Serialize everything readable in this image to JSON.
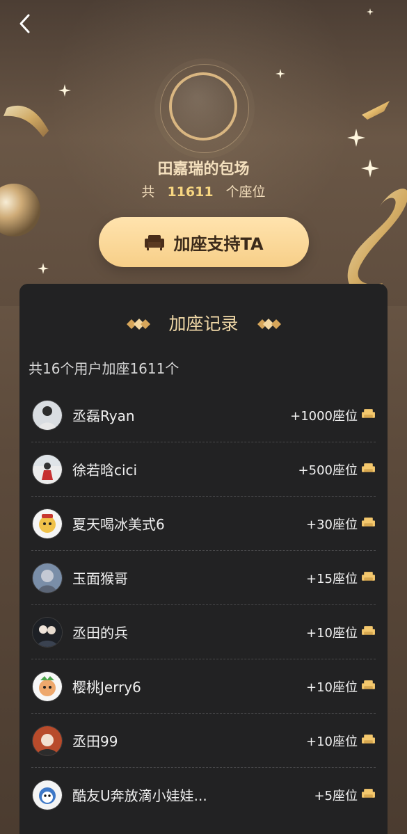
{
  "header": {
    "back_label": "",
    "title": "田嘉瑞的包场",
    "seat_prefix": "共",
    "seat_count": "11611",
    "seat_suffix": "个座位",
    "button_label": "加座支持TA"
  },
  "records": {
    "title": "加座记录",
    "summary": "共16个用户加座1611个",
    "items": [
      {
        "name": "丞磊Ryan",
        "count": "+1000座位"
      },
      {
        "name": "徐若晗cici",
        "count": "+500座位"
      },
      {
        "name": "夏天喝冰美式6",
        "count": "+30座位"
      },
      {
        "name": "玉面猴哥",
        "count": "+15座位"
      },
      {
        "name": "丞田的兵",
        "count": "+10座位"
      },
      {
        "name": "樱桃Jerry6",
        "count": "+10座位"
      },
      {
        "name": "丞田99",
        "count": "+10座位"
      },
      {
        "name": "酷友U奔放滴小娃娃...",
        "count": "+5座位"
      }
    ]
  },
  "icons": {
    "back": "chevron-left-icon",
    "sofa": "sofa-icon",
    "seat": "seat-icon"
  },
  "colors": {
    "gold": "#f7d681",
    "button_gradient_top": "#ffe3ae",
    "button_gradient_bottom": "#f7cf88",
    "card_bg": "#222223"
  }
}
